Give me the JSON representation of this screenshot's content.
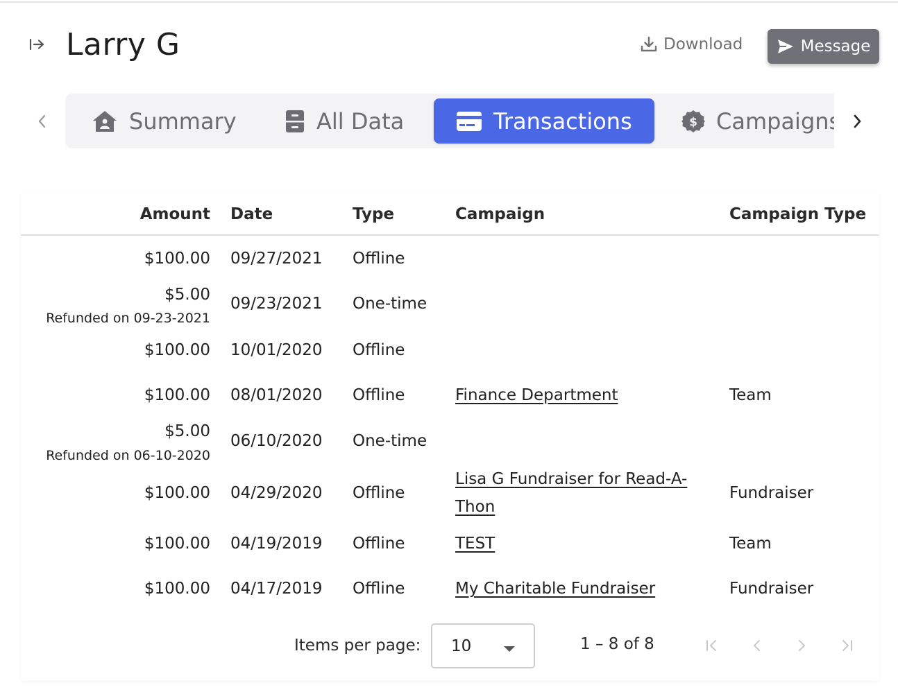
{
  "header": {
    "title": "Larry G",
    "download_label": "Download",
    "message_label": "Message"
  },
  "tabs": [
    {
      "label": "Summary",
      "icon": "house-icon"
    },
    {
      "label": "All Data",
      "icon": "file-cabinet-icon"
    },
    {
      "label": "Transactions",
      "icon": "credit-card-icon",
      "active": true
    },
    {
      "label": "Campaigns",
      "icon": "dollar-badge-icon"
    }
  ],
  "table": {
    "columns": [
      "Amount",
      "Date",
      "Type",
      "Campaign",
      "Campaign Type"
    ],
    "rows": [
      {
        "amount": "$100.00",
        "refund": "",
        "date": "09/27/2021",
        "type": "Offline",
        "campaign": "",
        "campaign_type": ""
      },
      {
        "amount": "$5.00",
        "refund": "Refunded on 09-23-2021",
        "date": "09/23/2021",
        "type": "One-time",
        "campaign": "",
        "campaign_type": ""
      },
      {
        "amount": "$100.00",
        "refund": "",
        "date": "10/01/2020",
        "type": "Offline",
        "campaign": "",
        "campaign_type": ""
      },
      {
        "amount": "$100.00",
        "refund": "",
        "date": "08/01/2020",
        "type": "Offline",
        "campaign": "Finance Department",
        "campaign_type": "Team"
      },
      {
        "amount": "$5.00",
        "refund": "Refunded on 06-10-2020",
        "date": "06/10/2020",
        "type": "One-time",
        "campaign": "",
        "campaign_type": ""
      },
      {
        "amount": "$100.00",
        "refund": "",
        "date": "04/29/2020",
        "type": "Offline",
        "campaign": "Lisa G Fundraiser for Read-A-Thon",
        "campaign_type": "Fundraiser"
      },
      {
        "amount": "$100.00",
        "refund": "",
        "date": "04/19/2019",
        "type": "Offline",
        "campaign": "TEST",
        "campaign_type": "Team"
      },
      {
        "amount": "$100.00",
        "refund": "",
        "date": "04/17/2019",
        "type": "Offline",
        "campaign": "My Charitable Fundraiser",
        "campaign_type": "Fundraiser"
      }
    ]
  },
  "paginator": {
    "items_per_page_label": "Items per page:",
    "items_per_page_value": "10",
    "range_label": "1 – 8 of 8"
  },
  "colors": {
    "accent": "#4a67e6",
    "message_button": "#6f7078",
    "muted_text": "#6c6c72"
  }
}
